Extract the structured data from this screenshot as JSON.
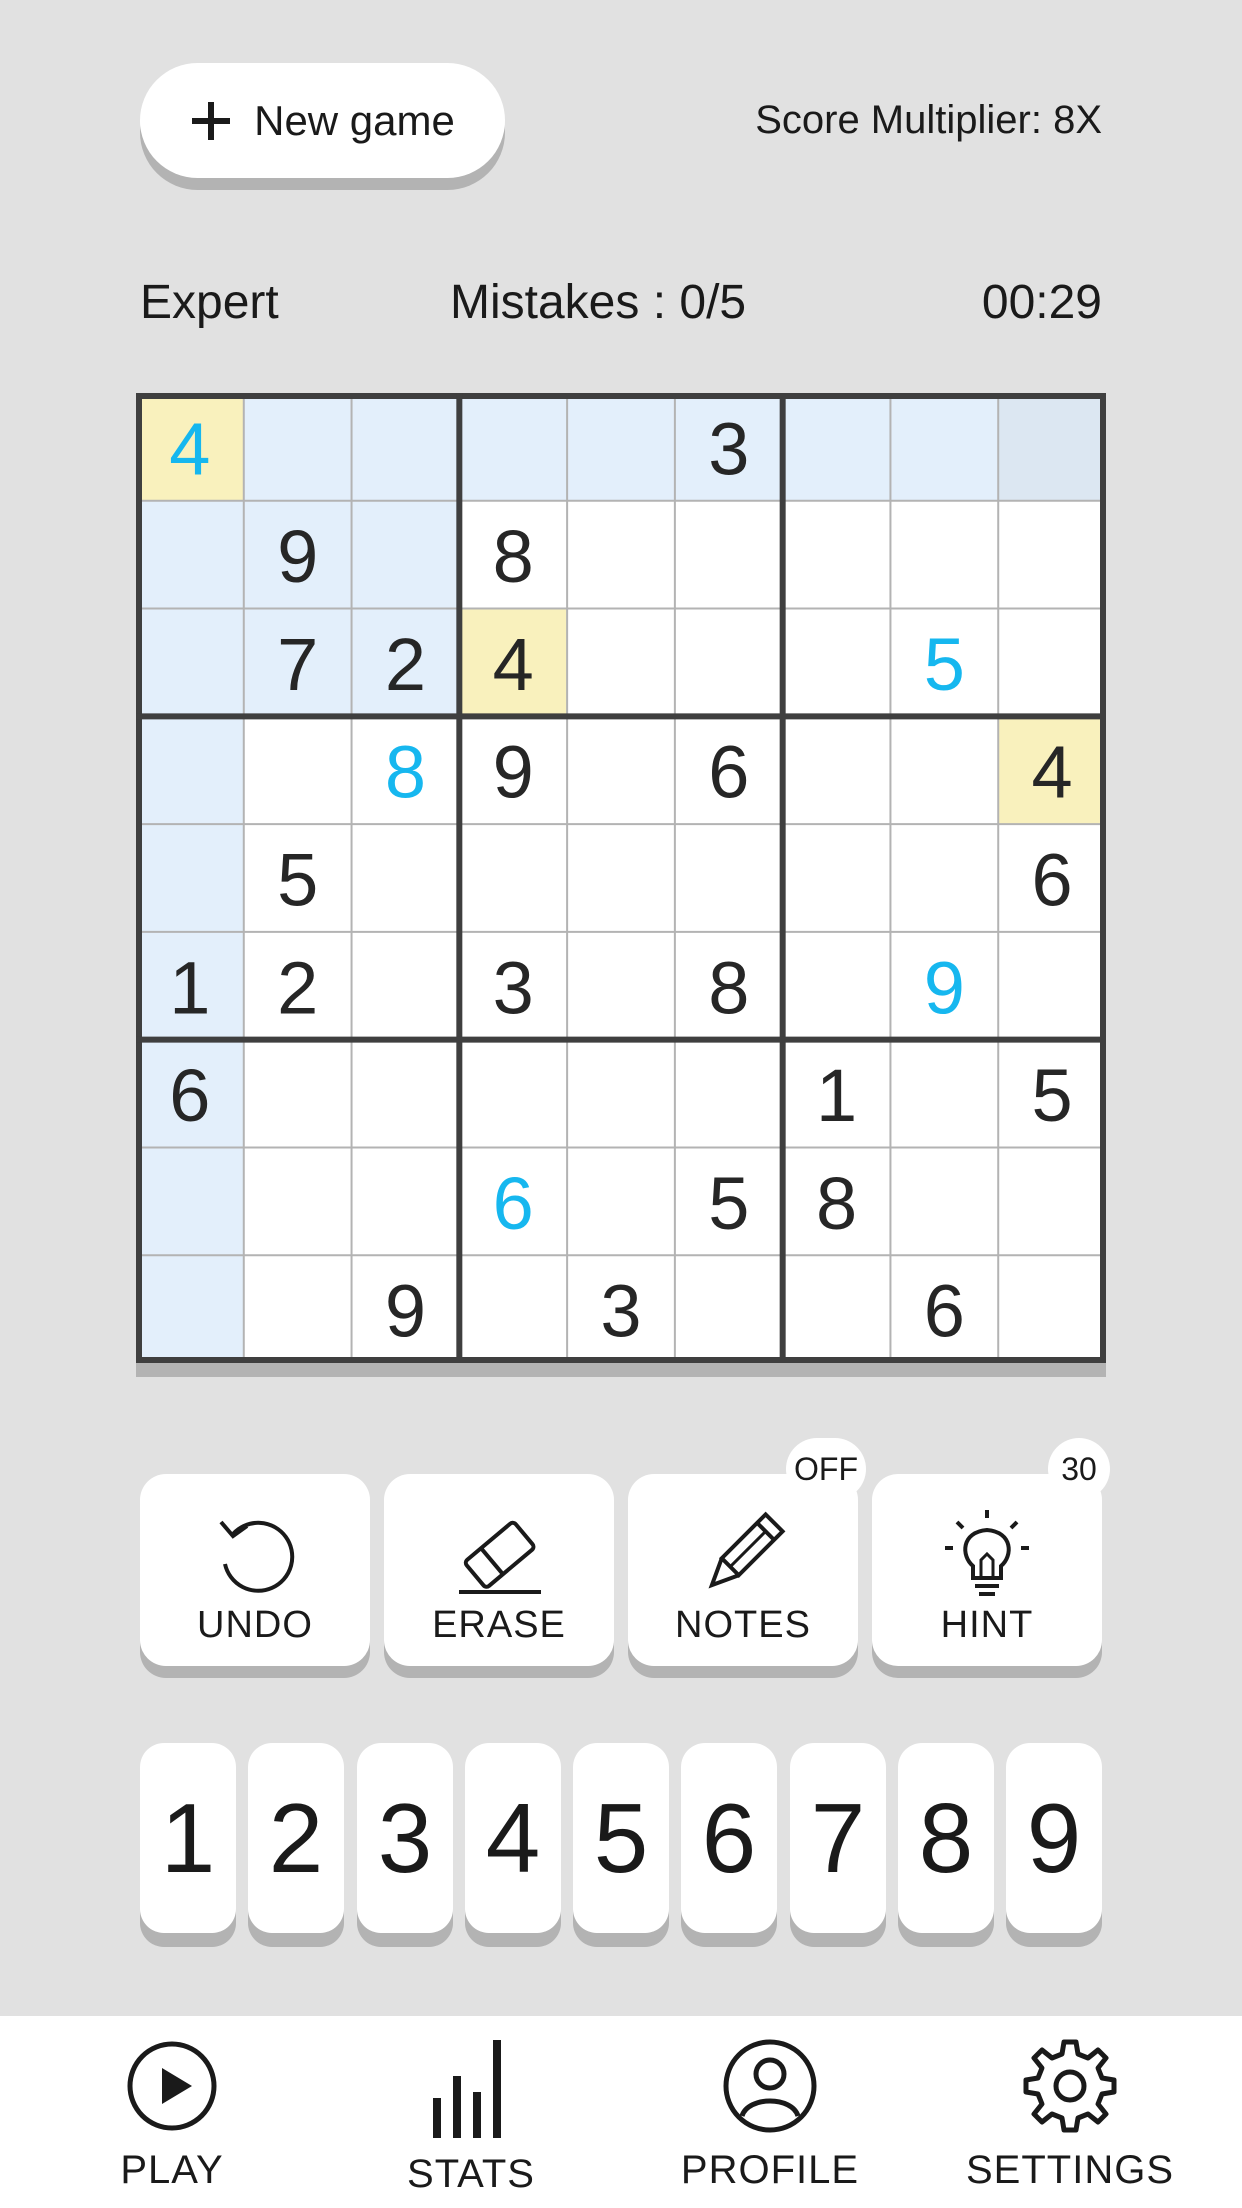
{
  "header": {
    "new_game_label": "New game",
    "score_multiplier": "Score Multiplier: 8X"
  },
  "status": {
    "difficulty": "Expert",
    "mistakes": "Mistakes : 0/5",
    "timer": "00:29"
  },
  "board": {
    "rows": [
      [
        {
          "v": "4",
          "c": "blue"
        },
        "",
        "",
        "",
        "",
        "3",
        "",
        "",
        ""
      ],
      [
        "",
        "9",
        "",
        "8",
        "",
        "",
        "",
        "",
        ""
      ],
      [
        "",
        "7",
        "2",
        "4",
        "",
        "",
        "",
        {
          "v": "5",
          "c": "blue"
        },
        ""
      ],
      [
        "",
        "",
        {
          "v": "8",
          "c": "blue"
        },
        "9",
        "",
        "6",
        "",
        "",
        "4"
      ],
      [
        "",
        "5",
        "",
        "",
        "",
        "",
        "",
        "",
        "6"
      ],
      [
        "1",
        "2",
        "",
        "3",
        "",
        "8",
        "",
        {
          "v": "9",
          "c": "blue"
        },
        ""
      ],
      [
        "6",
        "",
        "",
        "",
        "",
        "",
        "1",
        "",
        "5"
      ],
      [
        "",
        "",
        "",
        {
          "v": "6",
          "c": "blue"
        },
        "",
        "5",
        "8",
        "",
        ""
      ],
      [
        "",
        "",
        "9",
        "",
        "3",
        "",
        "",
        "6",
        ""
      ]
    ],
    "selected": [
      0,
      0
    ],
    "same_value_cells": [
      [
        2,
        3
      ],
      [
        3,
        8
      ]
    ],
    "colors": {
      "highlight": "#e3effb",
      "selected": "#f9f1bd",
      "same_value": "#f9f1bd",
      "corner": "#dce7f2",
      "given_text": "#262626",
      "user_text": "#16b7ef",
      "thin_line": "#b3b3b3",
      "thick_line": "#3f3f3f"
    }
  },
  "tools": [
    {
      "name": "undo",
      "label": "UNDO",
      "icon": "undo-icon"
    },
    {
      "name": "erase",
      "label": "ERASE",
      "icon": "eraser-icon"
    },
    {
      "name": "notes",
      "label": "NOTES",
      "icon": "pencil-icon",
      "badge": "OFF"
    },
    {
      "name": "hint",
      "label": "HINT",
      "icon": "lightbulb-icon",
      "badge": "30"
    }
  ],
  "numpad": [
    "1",
    "2",
    "3",
    "4",
    "5",
    "6",
    "7",
    "8",
    "9"
  ],
  "nav": [
    {
      "name": "play",
      "label": "PLAY",
      "icon": "play-icon"
    },
    {
      "name": "stats",
      "label": "STATS",
      "icon": "bar-chart-icon"
    },
    {
      "name": "profile",
      "label": "PROFILE",
      "icon": "user-icon"
    },
    {
      "name": "settings",
      "label": "SETTINGS",
      "icon": "gear-icon"
    }
  ]
}
